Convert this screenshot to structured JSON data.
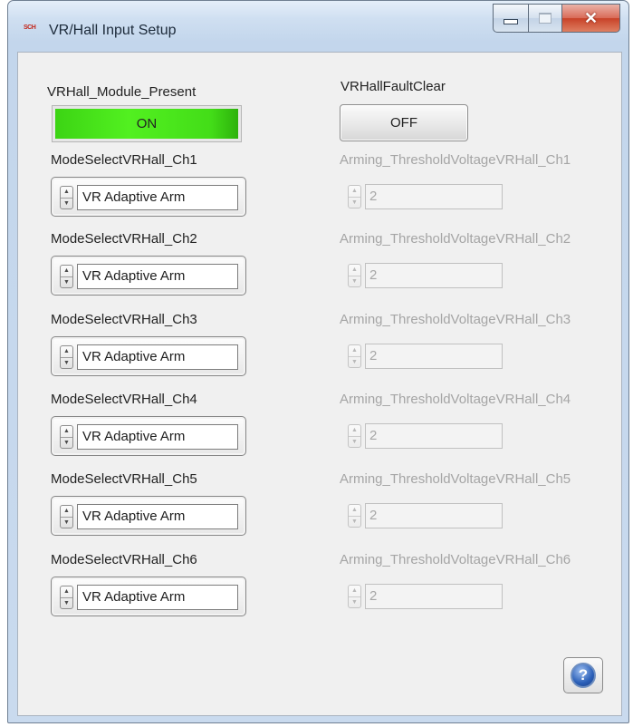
{
  "window": {
    "title": "VR/Hall Input Setup",
    "icon_text": "SCH"
  },
  "module_present": {
    "label": "VRHall_Module_Present",
    "value": "ON",
    "color": "#44e018"
  },
  "fault_clear": {
    "label": "VRHallFaultClear",
    "value": "OFF"
  },
  "channels": [
    {
      "mode_label": "ModeSelectVRHall_Ch1",
      "mode_value": "VR Adaptive Arm",
      "threshold_label": "Arming_ThresholdVoltageVRHall_Ch1",
      "threshold_value": "2"
    },
    {
      "mode_label": "ModeSelectVRHall_Ch2",
      "mode_value": "VR Adaptive Arm",
      "threshold_label": "Arming_ThresholdVoltageVRHall_Ch2",
      "threshold_value": "2"
    },
    {
      "mode_label": "ModeSelectVRHall_Ch3",
      "mode_value": "VR Adaptive Arm",
      "threshold_label": "Arming_ThresholdVoltageVRHall_Ch3",
      "threshold_value": "2"
    },
    {
      "mode_label": "ModeSelectVRHall_Ch4",
      "mode_value": "VR Adaptive Arm",
      "threshold_label": "Arming_ThresholdVoltageVRHall_Ch4",
      "threshold_value": "2"
    },
    {
      "mode_label": "ModeSelectVRHall_Ch5",
      "mode_value": "VR Adaptive Arm",
      "threshold_label": "Arming_ThresholdVoltageVRHall_Ch5",
      "threshold_value": "2"
    },
    {
      "mode_label": "ModeSelectVRHall_Ch6",
      "mode_value": "VR Adaptive Arm",
      "threshold_label": "Arming_ThresholdVoltageVRHall_Ch6",
      "threshold_value": "2"
    }
  ],
  "help": {
    "glyph": "?"
  },
  "colors": {
    "disabled_text": "#a5a5a5",
    "titlebar": "#cfdff1"
  }
}
